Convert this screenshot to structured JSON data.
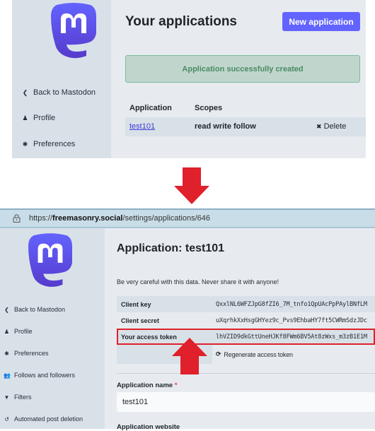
{
  "panel1": {
    "sidebar": {
      "logo": "mastodon-logo",
      "items": [
        {
          "icon": "chevron-left-icon",
          "glyph": "❮",
          "label": "Back to Mastodon"
        },
        {
          "icon": "user-icon",
          "glyph": "♟",
          "label": "Profile"
        },
        {
          "icon": "gear-icon",
          "glyph": "✱",
          "label": "Preferences"
        }
      ]
    },
    "title": "Your applications",
    "new_button": "New application",
    "flash": "Application successfully created",
    "table": {
      "headers": [
        "Application",
        "Scopes"
      ],
      "rows": [
        {
          "name": "test101",
          "scopes": "read write follow",
          "action_icon": "✖",
          "action": "Delete"
        }
      ]
    }
  },
  "browser": {
    "lock_icon": "🔒",
    "url_prefix": "https://",
    "url_domain": "freemasonry.social",
    "url_path": "/settings/applications/646"
  },
  "panel2": {
    "sidebar": {
      "items": [
        {
          "icon": "chevron-left-icon",
          "glyph": "❮",
          "label": "Back to Mastodon"
        },
        {
          "icon": "user-icon",
          "glyph": "♟",
          "label": "Profile"
        },
        {
          "icon": "gear-icon",
          "glyph": "✱",
          "label": "Preferences"
        },
        {
          "icon": "users-icon",
          "glyph": "👥",
          "label": "Follows and followers"
        },
        {
          "icon": "filter-icon",
          "glyph": "▼",
          "label": "Filters"
        },
        {
          "icon": "history-icon",
          "glyph": "↺",
          "label": "Automated post deletion"
        }
      ]
    },
    "title": "Application: test101",
    "warning": "Be very careful with this data. Never share it with anyone!",
    "keys": [
      {
        "label": "Client key",
        "value": "QxxlNL6WFZJpG8fZI6_7M_tnfo1QpUAcPpPAylBNfLM"
      },
      {
        "label": "Client secret",
        "value": "uXqrhkXxHsgGHYez9c_Pvs9EhbaHY7ft5CWRmSdzJDc"
      },
      {
        "label": "Your access token",
        "value": "lhVZID9dkGttUneHJKf8FWm6BV5At8zWxs_m3zB1E1M"
      }
    ],
    "regenerate_icon": "⟳",
    "regenerate": "Regenerate access token",
    "app_name_label": "Application name",
    "required_mark": "*",
    "app_name_value": "test101",
    "app_website_label": "Application website"
  },
  "colors": {
    "accent": "#6364ff",
    "arrow": "#e0202a",
    "flash_bg": "#c0d6cd",
    "flash_text": "#4a8a64"
  }
}
